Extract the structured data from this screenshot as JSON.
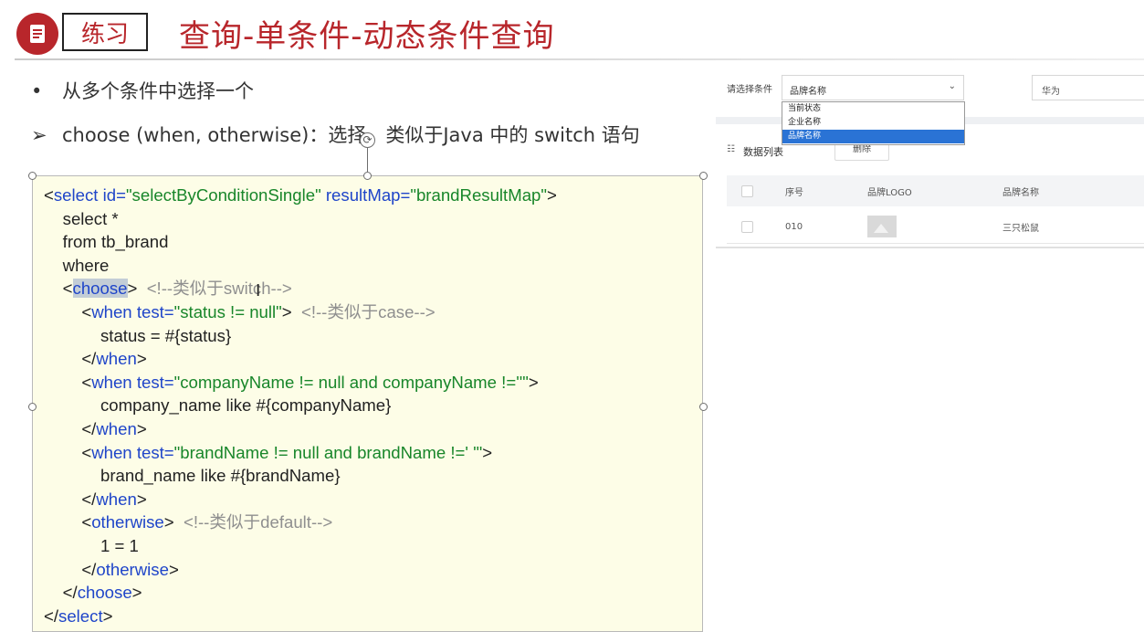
{
  "header": {
    "icon": "document-icon",
    "tag": "练习",
    "title": "查询-单条件-动态条件查询"
  },
  "bullets": [
    {
      "marker": "•",
      "text": "从多个条件中选择一个"
    },
    {
      "marker": "➢",
      "text": "choose (when, otherwise)：选择，类似于Java 中的 switch 语句"
    }
  ],
  "code": {
    "lines": [
      [
        {
          "t": "p",
          "v": "<"
        },
        {
          "t": "t",
          "v": "select"
        },
        {
          "t": "x",
          "v": " "
        },
        {
          "t": "t",
          "v": "id="
        },
        {
          "t": "v",
          "v": "\"selectByConditionSingle\""
        },
        {
          "t": "x",
          "v": " "
        },
        {
          "t": "t",
          "v": "resultMap="
        },
        {
          "t": "v",
          "v": "\"brandResultMap\""
        },
        {
          "t": "p",
          "v": ">"
        }
      ],
      [
        {
          "t": "x",
          "v": "    select *"
        }
      ],
      [
        {
          "t": "x",
          "v": "    from tb_brand"
        }
      ],
      [
        {
          "t": "x",
          "v": "    where"
        }
      ],
      [
        {
          "t": "x",
          "v": "    "
        },
        {
          "t": "p",
          "v": "<"
        },
        {
          "t": "h",
          "v": "choose"
        },
        {
          "t": "p",
          "v": ">"
        },
        {
          "t": "c",
          "v": "  <!--类似于switch-->"
        }
      ],
      [
        {
          "t": "x",
          "v": "        "
        },
        {
          "t": "p",
          "v": "<"
        },
        {
          "t": "t",
          "v": "when"
        },
        {
          "t": "x",
          "v": " "
        },
        {
          "t": "t",
          "v": "test="
        },
        {
          "t": "v",
          "v": "\"status != null\""
        },
        {
          "t": "p",
          "v": ">"
        },
        {
          "t": "c",
          "v": "  <!--类似于case-->"
        }
      ],
      [
        {
          "t": "x",
          "v": "            status = #{status}"
        }
      ],
      [
        {
          "t": "x",
          "v": "        "
        },
        {
          "t": "p",
          "v": "</"
        },
        {
          "t": "t",
          "v": "when"
        },
        {
          "t": "p",
          "v": ">"
        }
      ],
      [
        {
          "t": "x",
          "v": "        "
        },
        {
          "t": "p",
          "v": "<"
        },
        {
          "t": "t",
          "v": "when"
        },
        {
          "t": "x",
          "v": " "
        },
        {
          "t": "t",
          "v": "test="
        },
        {
          "t": "v",
          "v": "\"companyName != null and companyName !=''\""
        },
        {
          "t": "p",
          "v": ">"
        }
      ],
      [
        {
          "t": "x",
          "v": "            company_name like #{companyName}"
        }
      ],
      [
        {
          "t": "x",
          "v": "        "
        },
        {
          "t": "p",
          "v": "</"
        },
        {
          "t": "t",
          "v": "when"
        },
        {
          "t": "p",
          "v": ">"
        }
      ],
      [
        {
          "t": "x",
          "v": "        "
        },
        {
          "t": "p",
          "v": "<"
        },
        {
          "t": "t",
          "v": "when"
        },
        {
          "t": "x",
          "v": " "
        },
        {
          "t": "t",
          "v": "test="
        },
        {
          "t": "v",
          "v": "\"brandName != null and brandName !=' '\""
        },
        {
          "t": "p",
          "v": ">"
        }
      ],
      [
        {
          "t": "x",
          "v": "            brand_name like #{brandName}"
        }
      ],
      [
        {
          "t": "x",
          "v": "        "
        },
        {
          "t": "p",
          "v": "</"
        },
        {
          "t": "t",
          "v": "when"
        },
        {
          "t": "p",
          "v": ">"
        }
      ],
      [
        {
          "t": "x",
          "v": "        "
        },
        {
          "t": "p",
          "v": "<"
        },
        {
          "t": "t",
          "v": "otherwise"
        },
        {
          "t": "p",
          "v": ">"
        },
        {
          "t": "c",
          "v": "  <!--类似于default-->"
        }
      ],
      [
        {
          "t": "x",
          "v": "            1 = 1"
        }
      ],
      [
        {
          "t": "x",
          "v": "        "
        },
        {
          "t": "p",
          "v": "</"
        },
        {
          "t": "t",
          "v": "otherwise"
        },
        {
          "t": "p",
          "v": ">"
        }
      ],
      [
        {
          "t": "x",
          "v": "    "
        },
        {
          "t": "p",
          "v": "</"
        },
        {
          "t": "t",
          "v": "choose"
        },
        {
          "t": "p",
          "v": ">"
        }
      ],
      [
        {
          "t": "p",
          "v": "</"
        },
        {
          "t": "t",
          "v": "select"
        },
        {
          "t": "p",
          "v": ">"
        }
      ]
    ]
  },
  "app": {
    "filter_label": "请选择条件",
    "select_value": "品牌名称",
    "search_value": "华为",
    "dropdown_options": [
      "当前状态",
      "企业名称",
      "品牌名称"
    ],
    "dropdown_selected_index": 2,
    "list_label": "数据列表",
    "delete_label": "删除",
    "table": {
      "columns": [
        "序号",
        "品牌LOGO",
        "品牌名称"
      ],
      "rows": [
        {
          "index": "010",
          "logo": "image-placeholder-icon",
          "brand": "三只松鼠"
        }
      ]
    }
  },
  "colors": {
    "accent": "#b8262b",
    "code_bg": "#fdfde7",
    "tag_color": "#1f45c9",
    "attr_value": "#18862a",
    "comment": "#8f8f8f",
    "selected_option": "#2a73d5"
  }
}
